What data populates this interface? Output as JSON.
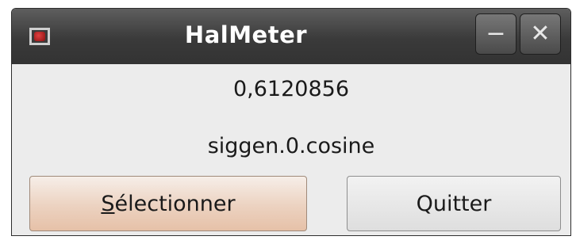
{
  "window": {
    "title": "HalMeter",
    "minimize_glyph": "−",
    "close_glyph": "✕"
  },
  "meter": {
    "value": "0,6120856",
    "signal": "siggen.0.cosine"
  },
  "buttons": {
    "select_mnemonic": "S",
    "select_rest": "électionner",
    "quit_label": "Quitter"
  },
  "colors": {
    "titlebar": "#3a3a3a",
    "window_bg": "#ececec",
    "select_button_bg": "#ecd2c0"
  },
  "icons": {
    "app": "halmeter-app-icon",
    "minimize": "minimize-icon",
    "close": "close-icon"
  }
}
